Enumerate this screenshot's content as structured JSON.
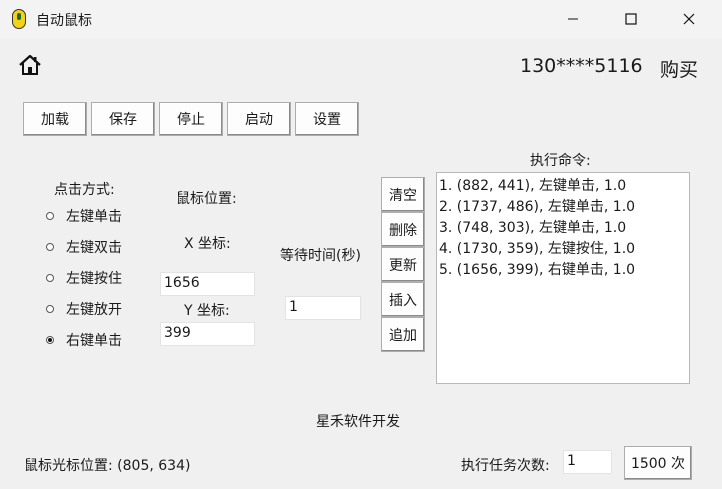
{
  "window": {
    "title": "自动鼠标",
    "controls": {
      "minimize": "−",
      "maximize": "☐",
      "close": "✕"
    }
  },
  "header": {
    "home_icon": "home-icon",
    "phone": "130****5116",
    "buy_label": "购买"
  },
  "toolbar": {
    "load": "加载",
    "save": "保存",
    "stop": "停止",
    "start": "启动",
    "settings": "设置"
  },
  "click_mode": {
    "label": "点击方式:",
    "options": [
      {
        "label": "左键单击",
        "selected": false
      },
      {
        "label": "左键双击",
        "selected": false
      },
      {
        "label": "左键按住",
        "selected": false
      },
      {
        "label": "左键放开",
        "selected": false
      },
      {
        "label": "右键单击",
        "selected": true
      }
    ]
  },
  "mouse_position": {
    "label": "鼠标位置:",
    "x_label": "X 坐标:",
    "x_value": "1656",
    "y_label": "Y 坐标:",
    "y_value": "399"
  },
  "wait": {
    "label": "等待时间(秒)",
    "value": "1"
  },
  "side_buttons": {
    "clear": "清空",
    "delete": "删除",
    "update": "更新",
    "insert": "插入",
    "append": "追加"
  },
  "commands": {
    "label": "执行命令:",
    "items": [
      "1. (882, 441), 左键单击, 1.0",
      "2. (1737, 486), 左键单击, 1.0",
      "3. (748, 303), 左键单击, 1.0",
      "4. (1730, 359), 左键按住, 1.0",
      "5. (1656, 399), 右键单击, 1.0"
    ]
  },
  "developer": "星禾软件开发",
  "footer": {
    "cursor_position": "鼠标光标位置: (805, 634)",
    "exec_label": "执行任务次数:",
    "exec_value": "1",
    "count_button": "1500 次"
  }
}
